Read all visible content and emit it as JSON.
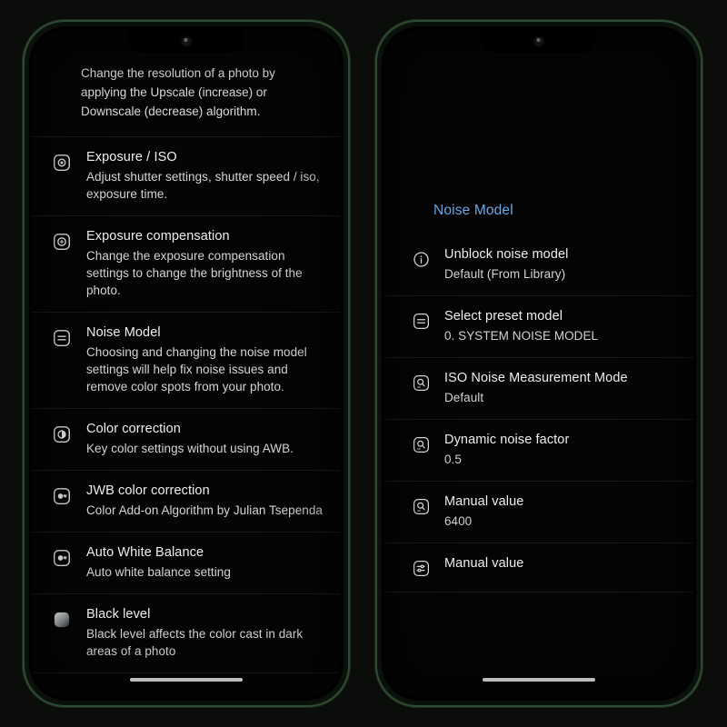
{
  "theme": {
    "background": "#0b0d0b",
    "screen_background": "#050505",
    "frame_border": "#2f4a32",
    "accent_blue": "#6ca9e8",
    "title_color": "#eceff1",
    "subtitle_color": "#d2d6d8",
    "divider": "#1a1c1a",
    "home_indicator": "#b9bdbe"
  },
  "left_phone": {
    "lead_paragraph": "Change the resolution of a photo by applying the Upscale (increase) or Downscale (decrease) algorithm.",
    "items": [
      {
        "icon": "exposure-iso-icon",
        "title": "Exposure / ISO",
        "subtitle": "Adjust shutter settings, shutter speed / iso, exposure time."
      },
      {
        "icon": "exposure-compensation-icon",
        "title": "Exposure compensation",
        "subtitle": "Change the exposure compensation settings to change the brightness of the photo."
      },
      {
        "icon": "noise-model-icon",
        "title": "Noise Model",
        "subtitle": "Choosing and changing the noise model settings will help fix noise issues and remove color spots from your photo."
      },
      {
        "icon": "color-correction-icon",
        "title": "Color correction",
        "subtitle": "Key color settings without using AWB."
      },
      {
        "icon": "jwb-color-correction-icon",
        "title": "JWB color correction",
        "subtitle": "Color Add-on Algorithm by Julian Tsependa"
      },
      {
        "icon": "auto-white-balance-icon",
        "title": "Auto White Balance",
        "subtitle": "Auto white balance setting"
      },
      {
        "icon": "black-level-icon",
        "title": "Black level",
        "subtitle": "Black level affects the color cast in dark areas of a photo"
      }
    ]
  },
  "right_phone": {
    "section_title": "Noise Model",
    "items": [
      {
        "icon": "info-circle-icon",
        "title": "Unblock noise model",
        "subtitle": "Default (From Library)"
      },
      {
        "icon": "preset-model-icon",
        "title": "Select preset model",
        "subtitle": "0. SYSTEM NOISE MODEL"
      },
      {
        "icon": "iso-noise-measurement-icon",
        "title": "ISO Noise Measurement Mode",
        "subtitle": "Default"
      },
      {
        "icon": "dynamic-noise-factor-icon",
        "title": "Dynamic noise factor",
        "subtitle": "0.5"
      },
      {
        "icon": "manual-value-icon",
        "title": "Manual value",
        "subtitle": "6400"
      },
      {
        "icon": "tune-sliders-icon",
        "title": "Manual value",
        "subtitle": ""
      }
    ]
  }
}
